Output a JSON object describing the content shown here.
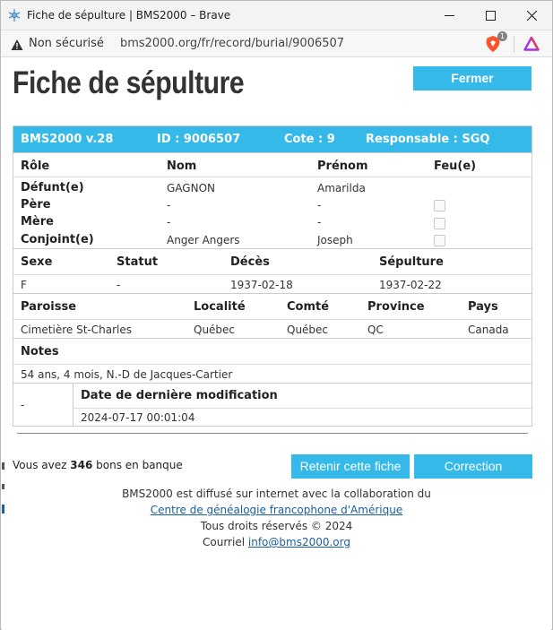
{
  "window": {
    "title": "Fiche de sépulture | BMS2000 – Brave"
  },
  "addressbar": {
    "security": "Non sécurisé",
    "url": "bms2000.org/fr/record/burial/9006507",
    "shield_count": "1"
  },
  "page": {
    "title": "Fiche de sépulture",
    "close_label": "Fermer",
    "header": {
      "version": "BMS2000 v.28",
      "id": "ID : 9006507",
      "cote": "Cote : 9",
      "responsable": "Responsable : SGQ"
    },
    "persons": {
      "headers": [
        "Rôle",
        "Nom",
        "Prénom",
        "Feu(e)"
      ],
      "rows": [
        {
          "role": "Défunt(e)",
          "nom": "GAGNON",
          "prenom": "Amarilda",
          "checkbox": false
        },
        {
          "role": "Père",
          "nom": "-",
          "prenom": "-",
          "checkbox": true
        },
        {
          "role": "Mère",
          "nom": "-",
          "prenom": "-",
          "checkbox": true
        },
        {
          "role": "Conjoint(e)",
          "nom": "Anger Angers",
          "prenom": "Joseph",
          "checkbox": true
        }
      ]
    },
    "facts": {
      "headers": [
        "Sexe",
        "Statut",
        "Décès",
        "Sépulture"
      ],
      "values": [
        "F",
        "-",
        "1937-02-18",
        "1937-02-22"
      ]
    },
    "place": {
      "headers": [
        "Paroisse",
        "Localité",
        "Comté",
        "Province",
        "Pays"
      ],
      "values": [
        "Cimetière St-Charles",
        "Québec",
        "Québec",
        "QC",
        "Canada"
      ]
    },
    "notes": {
      "label": "Notes",
      "text": "54 ans, 4 mois, N.-D de Jacques-Cartier"
    },
    "modified": {
      "left": "-",
      "label": "Date de dernière modification",
      "value": "2024-07-17 00:01:04"
    },
    "bank": {
      "prefix": "Vous avez",
      "count": "346",
      "suffix": "bons en banque"
    },
    "keep_label": "Retenir cette fiche",
    "correction_label": "Correction",
    "footer": {
      "line1": "BMS2000 est diffusé sur internet avec la collaboration du",
      "link1": "Centre de généalogie francophone d'Amérique",
      "line3": "Tous droits réservés © 2024",
      "line4_prefix": "Courriel",
      "email": "info@bms2000.org"
    }
  },
  "colors": {
    "accent": "#35b9e9"
  }
}
